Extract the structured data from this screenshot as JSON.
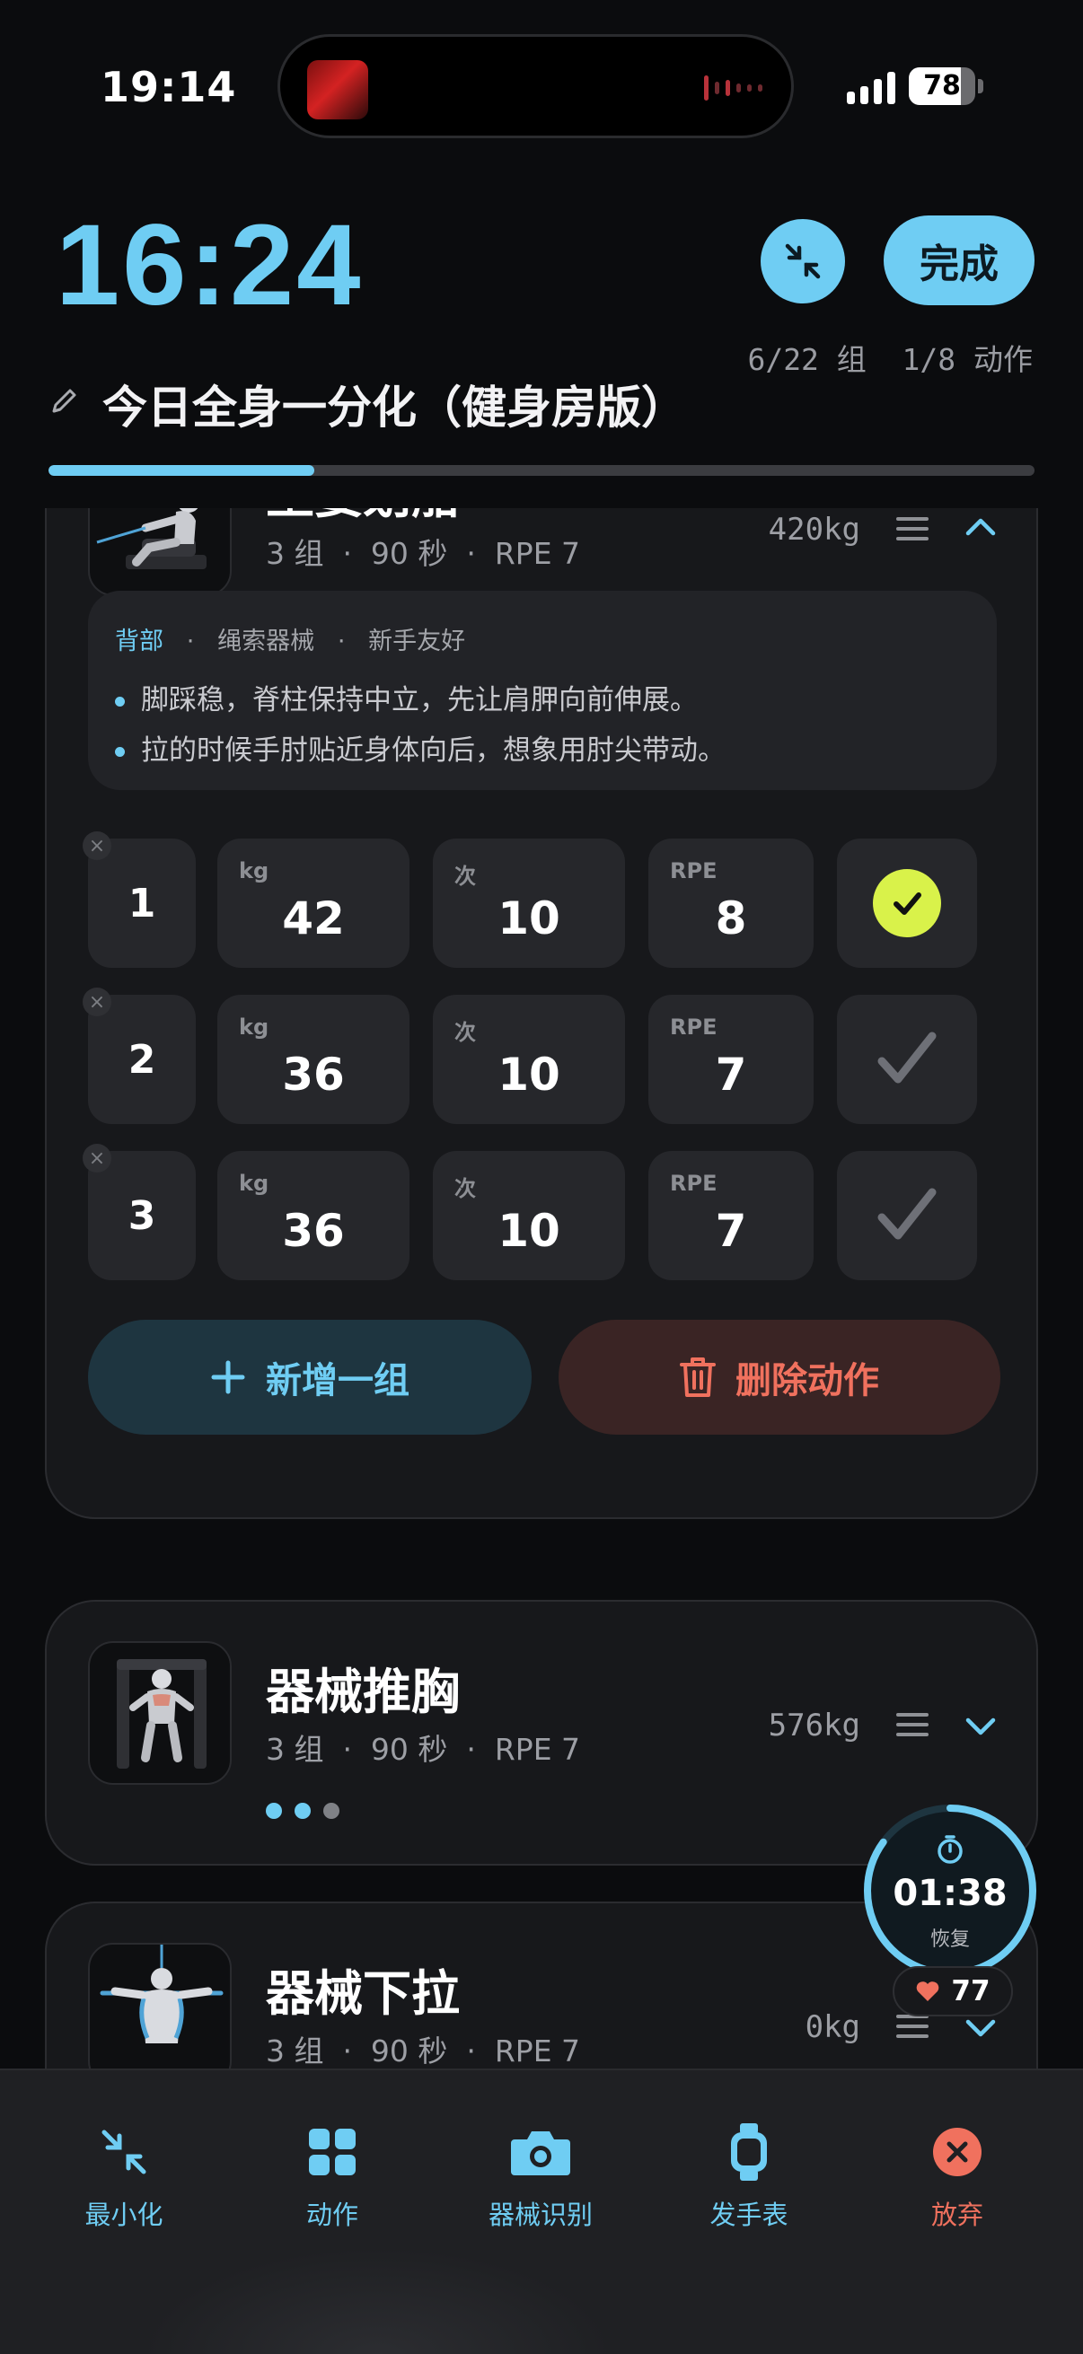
{
  "status_bar": {
    "time": "19:14",
    "battery": "78",
    "battery_level": 0.78
  },
  "header": {
    "elapsed": "16:24",
    "done_label": "完成",
    "counts": "6/22 组  1/8 动作",
    "workout_title": "今日全身一分化（健身房版）",
    "progress": 0.27
  },
  "exercises": [
    {
      "name": "坐姿划船",
      "meta": "3 组  ·  90 秒  ·  RPE 7",
      "volume": "420kg",
      "tags": [
        "背部",
        "绳索器械",
        "新手友好"
      ],
      "tips": [
        "脚踩稳，脊柱保持中立，先让肩胛向前伸展。",
        "拉的时候手肘贴近身体向后，想象用肘尖带动。"
      ],
      "labels": {
        "kg": "kg",
        "reps": "次",
        "rpe": "RPE"
      },
      "sets": [
        {
          "num": "1",
          "kg": "42",
          "reps": "10",
          "rpe": "8",
          "done": true
        },
        {
          "num": "2",
          "kg": "36",
          "reps": "10",
          "rpe": "7",
          "done": false
        },
        {
          "num": "3",
          "kg": "36",
          "reps": "10",
          "rpe": "7",
          "done": false
        }
      ],
      "add_set_label": "新增一组",
      "delete_label": "删除动作",
      "remove_symbol": "×"
    },
    {
      "name": "器械推胸",
      "meta": "3 组  ·  90 秒  ·  RPE 7",
      "volume": "576kg"
    },
    {
      "name": "器械下拉",
      "meta": "3 组  ·  90 秒  ·  RPE 7",
      "volume": "0kg"
    }
  ],
  "rest_timer": {
    "time": "01:38",
    "label": "恢复",
    "heart_rate": "77",
    "progress": 0.85
  },
  "bottom_nav": [
    {
      "label": "最小化",
      "icon": "minimize-icon"
    },
    {
      "label": "动作",
      "icon": "grid-icon"
    },
    {
      "label": "器械识别",
      "icon": "camera-icon"
    },
    {
      "label": "发手表",
      "icon": "watch-icon"
    },
    {
      "label": "放弃",
      "icon": "close-circle-icon"
    }
  ],
  "colors": {
    "accent": "#6fcdf3",
    "danger": "#f0715e",
    "done": "#d9f24a",
    "background": "#0b0c0e"
  }
}
